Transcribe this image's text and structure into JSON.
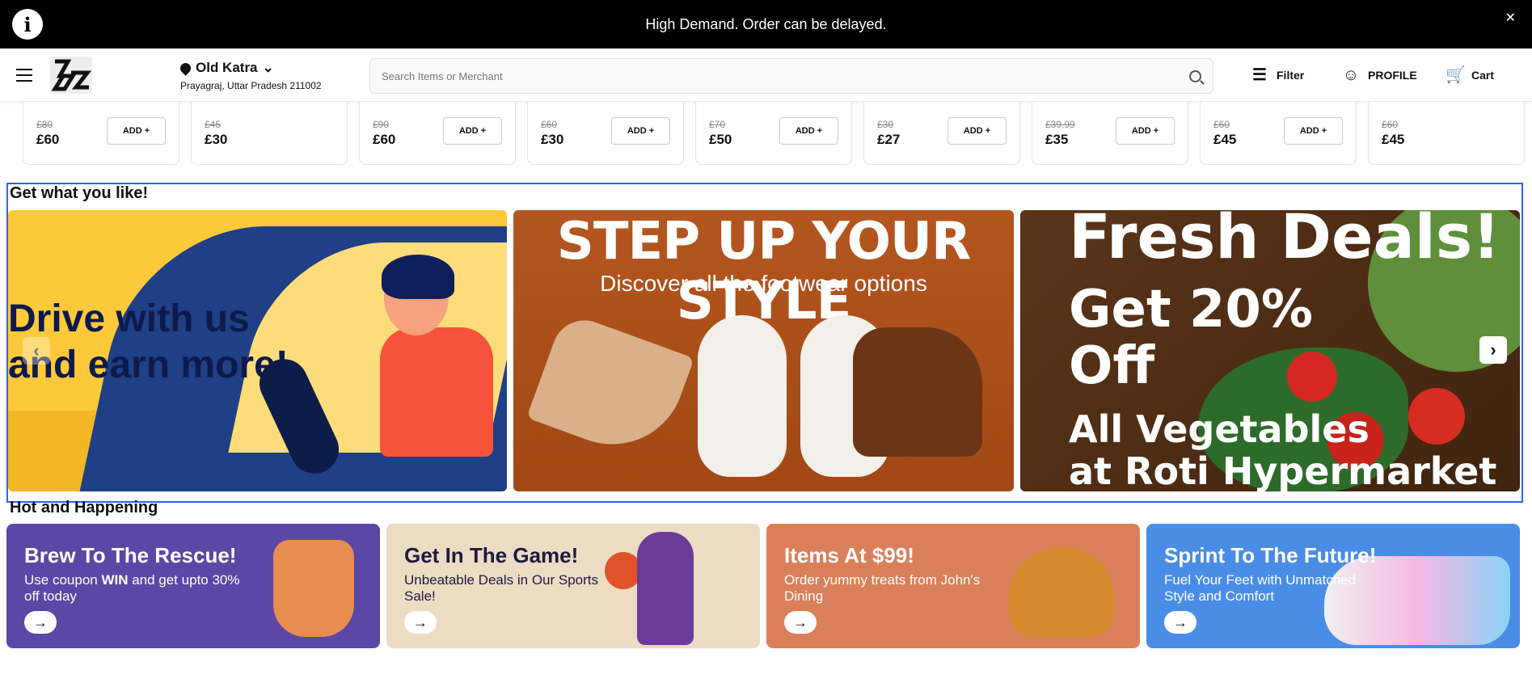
{
  "notice": {
    "message": "High Demand. Order can be delayed.",
    "close": "✕",
    "info_icon": "i"
  },
  "header": {
    "location_city": "Old Katra",
    "location_address": "Prayagraj, Uttar Pradesh 211002",
    "search_placeholder": "Search Items or Merchant",
    "filter_label": "Filter",
    "profile_label": "PROFILE",
    "cart_label": "Cart"
  },
  "products": [
    {
      "old": "£80",
      "new": "£60",
      "add": "ADD +"
    },
    {
      "old": "£45",
      "new": "£30",
      "add": ""
    },
    {
      "old": "£90",
      "new": "£60",
      "add": "ADD +"
    },
    {
      "old": "£60",
      "new": "£30",
      "add": "ADD +"
    },
    {
      "old": "£70",
      "new": "£50",
      "add": "ADD +"
    },
    {
      "old": "£30",
      "new": "£27",
      "add": "ADD +"
    },
    {
      "old": "£39.99",
      "new": "£35",
      "add": "ADD +"
    },
    {
      "old": "£60",
      "new": "£45",
      "add": "ADD +"
    },
    {
      "old": "£60",
      "new": "£45",
      "add": ""
    }
  ],
  "section1": {
    "title": "Get what you like!",
    "banners": [
      {
        "line1": "Drive with us",
        "line2": "and earn more!"
      },
      {
        "line1": "STEP UP YOUR STYLE",
        "line2": "Discover all the footwear options"
      },
      {
        "line1": "Fresh Deals!",
        "line2": "Get 20%",
        "line3": "Off",
        "line4": "All Vegetables",
        "line5": "at Roti Hypermarket"
      }
    ],
    "prev": "‹",
    "next": "›"
  },
  "section2": {
    "title": "Hot and Happening",
    "cards": [
      {
        "title": "Brew To The Rescue!",
        "sub_pre": "Use coupon ",
        "sub_bold": "WIN",
        "sub_post": " and get upto 30% off today"
      },
      {
        "title": "Get In The Game!",
        "sub": "Unbeatable Deals in Our Sports Sale!"
      },
      {
        "title": "Items At $99!",
        "sub": "Order yummy treats from John's Dining"
      },
      {
        "title": "Sprint To The Future!",
        "sub": "Fuel Your Feet with Unmatched Style and Comfort"
      }
    ],
    "go": "→"
  },
  "colors": {
    "accent_border": "#2e63f5",
    "topbar": "#000000"
  }
}
